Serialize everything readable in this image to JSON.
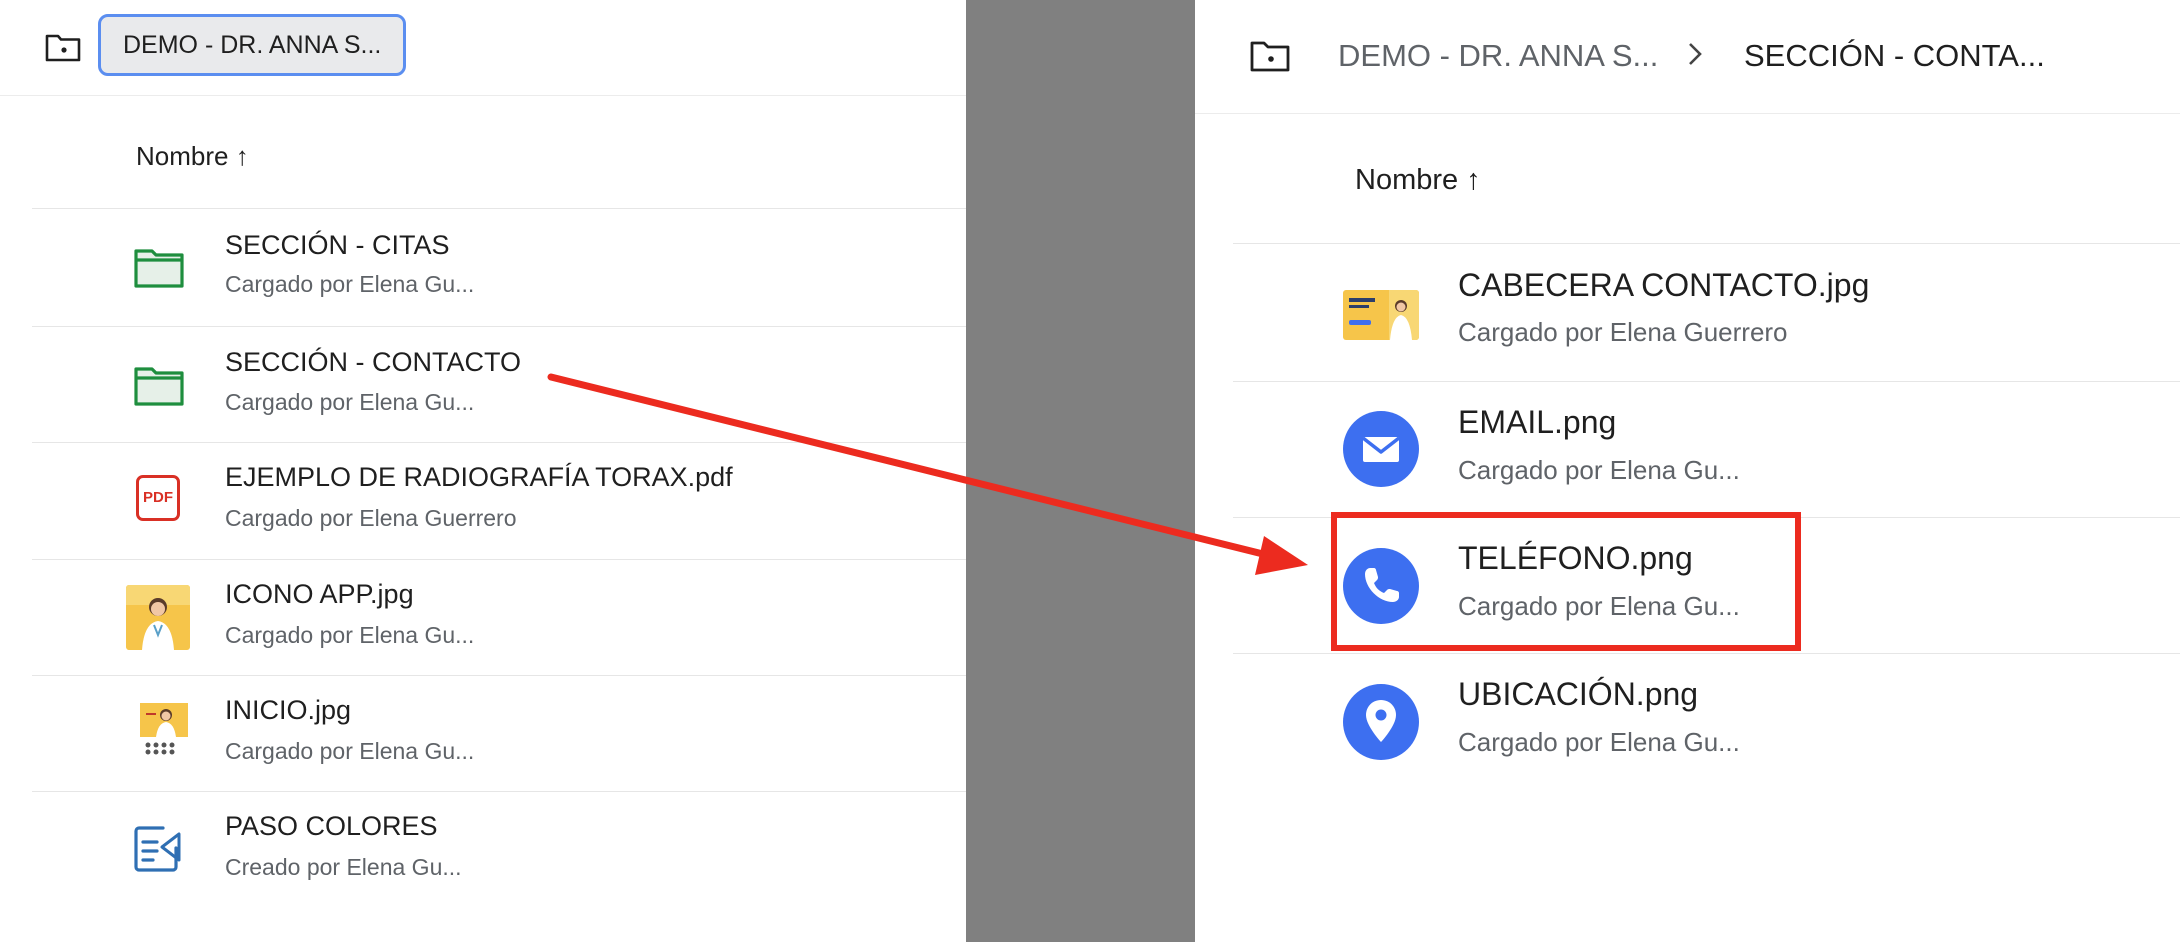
{
  "left": {
    "breadcrumb_chip": "DEMO - DR. ANNA S...",
    "column_header": "Nombre ↑",
    "rows": [
      {
        "title": "SECCIÓN - CITAS",
        "subtitle": "Cargado por Elena Gu...",
        "icon": "folder-icon"
      },
      {
        "title": "SECCIÓN - CONTACTO",
        "subtitle": "Cargado por Elena Gu...",
        "icon": "folder-icon"
      },
      {
        "title": "EJEMPLO DE RADIOGRAFÍA TORAX.pdf",
        "subtitle": "Cargado por Elena Guerrero",
        "icon": "pdf-icon",
        "icon_text": "PDF"
      },
      {
        "title": "ICONO APP.jpg",
        "subtitle": "Cargado por Elena Gu...",
        "icon": "image-thumbnail"
      },
      {
        "title": "INICIO.jpg",
        "subtitle": "Cargado por Elena Gu...",
        "icon": "image-thumbnail"
      },
      {
        "title": "PASO COLORES",
        "subtitle": "Creado por Elena Gu...",
        "icon": "form-icon"
      }
    ]
  },
  "right": {
    "breadcrumb": [
      "DEMO - DR. ANNA S...",
      "SECCIÓN - CONTA..."
    ],
    "column_header": "Nombre ↑",
    "rows": [
      {
        "title": "CABECERA CONTACTO.jpg",
        "subtitle": "Cargado por Elena Guerrero",
        "icon": "image-thumbnail"
      },
      {
        "title": "EMAIL.png",
        "subtitle": "Cargado por Elena Gu...",
        "icon": "email-icon"
      },
      {
        "title": "TELÉFONO.png",
        "subtitle": "Cargado por Elena Gu...",
        "icon": "phone-icon"
      },
      {
        "title": "UBICACIÓN.png",
        "subtitle": "Cargado por Elena Gu...",
        "icon": "location-icon"
      }
    ]
  },
  "colors": {
    "folder_green": "#1e8e3e",
    "folder_fill": "#e6f0e8",
    "pdf_red": "#d93025",
    "icon_blue": "#3d6ff0",
    "highlight_red": "#ec2b1f",
    "divider_gray": "#808080"
  }
}
